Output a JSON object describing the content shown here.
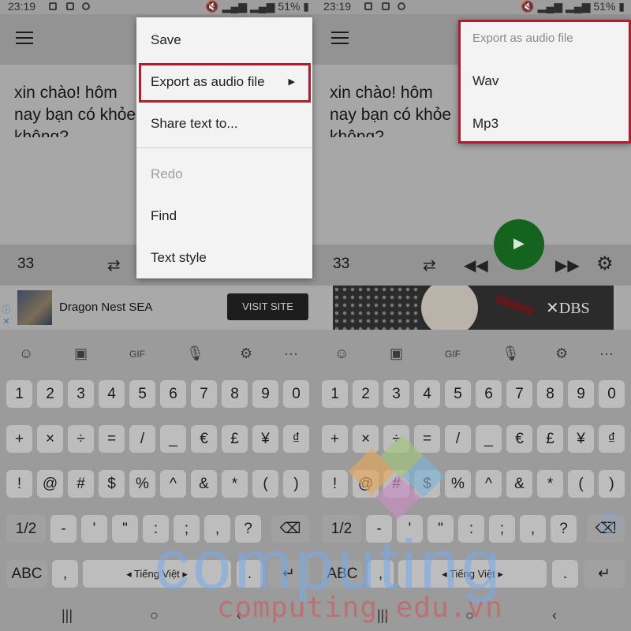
{
  "status": {
    "time": "23:19",
    "battery": "51%"
  },
  "editor": {
    "text": "xin chào! hôm nay bạn có khỏe\nkhông?"
  },
  "controls": {
    "count": "33"
  },
  "ad": {
    "title": "Dragon Nest SEA",
    "button": "VISIT SITE"
  },
  "banner": {
    "brand": "DBS"
  },
  "menu": {
    "items": [
      "Save",
      "Export as audio file",
      "Share text to...",
      "Redo",
      "Find",
      "Text style"
    ]
  },
  "submenu": {
    "header": "Export as audio file",
    "items": [
      "Wav",
      "Mp3"
    ]
  },
  "keyboard": {
    "row1": [
      "1",
      "2",
      "3",
      "4",
      "5",
      "6",
      "7",
      "8",
      "9",
      "0"
    ],
    "row2": [
      "+",
      "×",
      "÷",
      "=",
      "/",
      "_",
      "€",
      "£",
      "¥",
      "₫"
    ],
    "row3": [
      "!",
      "@",
      "#",
      "$",
      "%",
      "^",
      "&",
      "*",
      "(",
      ")"
    ],
    "row4": [
      "1/2",
      "-",
      "'",
      "\"",
      ":",
      ";",
      ",",
      "?"
    ],
    "abc": "ABC",
    "comma": ",",
    "space": "Tiếng Việt",
    "period": "."
  },
  "watermark": {
    "text1": "computing",
    "text2": "computing.edu.vn"
  },
  "colors": {
    "highlight": "#b01d2d",
    "play": "#14631f"
  }
}
